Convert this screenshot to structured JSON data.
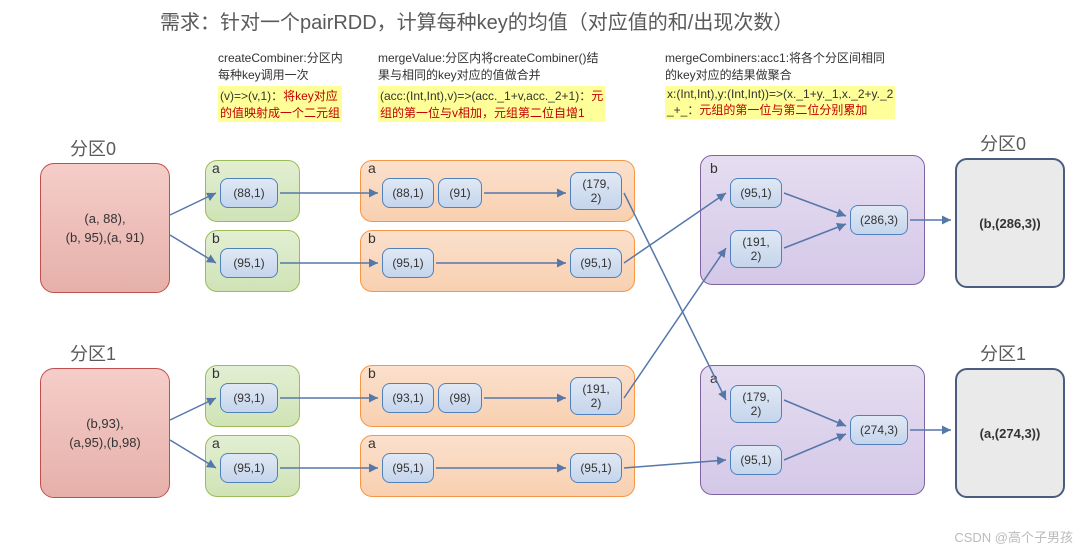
{
  "title": "需求：针对一个pairRDD，计算每种key的均值（对应值的和/出现次数）",
  "columns": {
    "createCombiner": {
      "desc": "createCombiner:分区内\n每种key调用一次",
      "code_a": "(v)=>(v,1)：",
      "code_b": "将key对应\n的值映射成一个二元组"
    },
    "mergeValue": {
      "desc": "mergeValue:分区内将createCombiner()结\n果与相同的key对应的值做合并",
      "code_a": "(acc:(Int,Int),v)=>(acc._1+v,acc._2+1)：",
      "code_b": "元\n组的第一位与v相加，元组第二位自增1"
    },
    "mergeCombiners": {
      "desc": "mergeCombiners:acc1:将各个分区间相同\n的key对应的结果做聚合",
      "code_a": "x:(Int,Int),y:(Int,Int))=>(x._1+y._1,x._2+y._2\n_+_：",
      "code_b": "元组的第一位与第二位分别累加"
    }
  },
  "partitions": {
    "p0": {
      "label": "分区0",
      "input": "(a, 88),\n(b, 95),(a, 91)",
      "green": {
        "row_a": {
          "key": "a",
          "val": "(88,1)"
        },
        "row_b": {
          "key": "b",
          "val": "(95,1)"
        }
      },
      "orange": {
        "row_a": {
          "key": "a",
          "n1": "(88,1)",
          "n2": "(91)",
          "out": "(179,\n2)"
        },
        "row_b": {
          "key": "b",
          "n1": "(95,1)",
          "out": "(95,1)"
        }
      }
    },
    "p1": {
      "label": "分区1",
      "input": "(b,93),\n(a,95),(b,98)",
      "green": {
        "row_b": {
          "key": "b",
          "val": "(93,1)"
        },
        "row_a": {
          "key": "a",
          "val": "(95,1)"
        }
      },
      "orange": {
        "row_b": {
          "key": "b",
          "n1": "(93,1)",
          "n2": "(98)",
          "out": "(191,\n2)"
        },
        "row_a": {
          "key": "a",
          "n1": "(95,1)",
          "out": "(95,1)"
        }
      }
    }
  },
  "purple": {
    "group_b": {
      "key": "b",
      "n1": "(95,1)",
      "n2": "(191,\n2)",
      "out": "(286,3)"
    },
    "group_a": {
      "key": "a",
      "n1": "(179,\n2)",
      "n2": "(95,1)",
      "out": "(274,3)"
    }
  },
  "output": {
    "p0": {
      "label": "分区0",
      "val": "(b,(286,3))"
    },
    "p1": {
      "label": "分区1",
      "val": "(a,(274,3))"
    }
  },
  "watermark": "CSDN @高个子男孩"
}
